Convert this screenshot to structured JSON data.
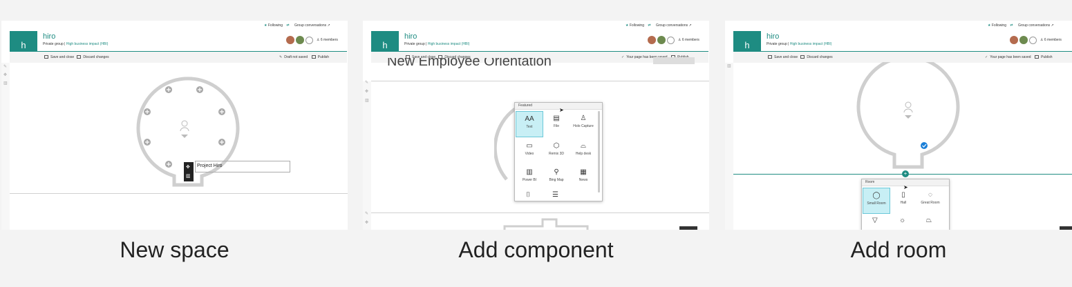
{
  "captions": [
    "New space",
    "Add component",
    "Add room"
  ],
  "header": {
    "site_name": "hiro",
    "tile_letter": "h",
    "privacy": "Private group",
    "separator": "|",
    "classification": "High business impact (HBI)",
    "following": "Following",
    "group_conversations": "Group conversations",
    "members": "6 members"
  },
  "commands": {
    "save_close": "Save and close",
    "discard": "Discard changes",
    "draft_status": "Draft not saved",
    "saved_status": "Your page has been saved",
    "publish": "Publish"
  },
  "panel1": {
    "label_input_value": "Project Hiro"
  },
  "panel2": {
    "page_title": "New Employee Orientation",
    "picker_header": "Featured",
    "items": [
      {
        "label": "Text",
        "icon": "text-icon",
        "glyph": "AA"
      },
      {
        "label": "File",
        "icon": "file-icon",
        "glyph": "▤"
      },
      {
        "label": "Holo Capture",
        "icon": "holo-capture-icon",
        "glyph": "♙"
      },
      {
        "label": "Video",
        "icon": "video-icon",
        "glyph": "▭"
      },
      {
        "label": "Remix 3D",
        "icon": "remix-3d-icon",
        "glyph": "⬡"
      },
      {
        "label": "Help desk",
        "icon": "help-desk-icon",
        "glyph": "⌓"
      },
      {
        "label": "Power BI",
        "icon": "power-bi-icon",
        "glyph": "▥"
      },
      {
        "label": "Bing Map",
        "icon": "bing-map-icon",
        "glyph": "⚲"
      },
      {
        "label": "News",
        "icon": "news-icon",
        "glyph": "▦"
      }
    ]
  },
  "panel3": {
    "picker_header": "Room",
    "items": [
      {
        "label": "Small Room",
        "icon": "small-room-icon",
        "glyph": "◯"
      },
      {
        "label": "Hall",
        "icon": "hall-icon",
        "glyph": "▯"
      },
      {
        "label": "Great Room",
        "icon": "great-room-icon",
        "glyph": "◌"
      }
    ]
  },
  "colors": {
    "accent": "#1e8c82",
    "selected": "#c8eff5",
    "check": "#1b7fd8"
  }
}
